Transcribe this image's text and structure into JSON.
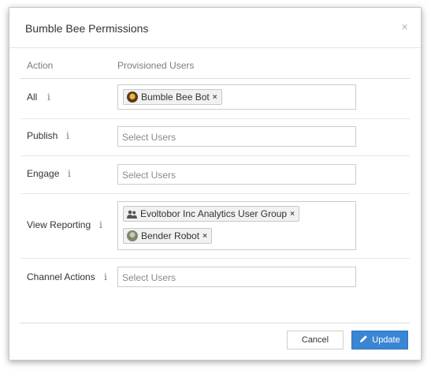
{
  "modal": {
    "title": "Bumble Bee Permissions",
    "close_glyph": "×"
  },
  "columns": {
    "action": "Action",
    "users": "Provisioned Users"
  },
  "info_glyph": "i",
  "rows": [
    {
      "label": "All",
      "chips": [
        {
          "text": "Bumble Bee Bot",
          "icon": "bee-avatar-icon"
        }
      ],
      "placeholder": ""
    },
    {
      "label": "Publish",
      "chips": [],
      "placeholder": "Select Users"
    },
    {
      "label": "Engage",
      "chips": [],
      "placeholder": "Select Users"
    },
    {
      "label": "View Reporting",
      "chips": [
        {
          "text": "Evoltobor Inc Analytics User Group",
          "icon": "user-group-icon"
        },
        {
          "text": "Bender Robot",
          "icon": "robot-avatar-icon"
        }
      ],
      "placeholder": ""
    },
    {
      "label": "Channel Actions",
      "chips": [],
      "placeholder": "Select Users"
    }
  ],
  "chip_remove_glyph": "×",
  "buttons": {
    "cancel": "Cancel",
    "update": "Update"
  },
  "colors": {
    "primary": "#3a86d4",
    "text": "#333333",
    "muted": "#7d7d7d"
  }
}
